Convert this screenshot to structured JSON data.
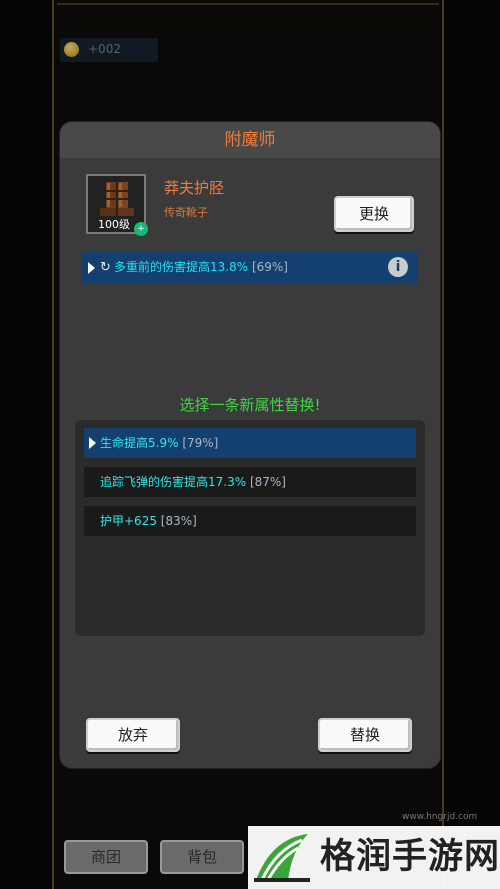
{
  "background": {
    "coin_value": "+002",
    "bottom_buttons": [
      "商团",
      "背包"
    ]
  },
  "dialog": {
    "title": "附魔师",
    "item": {
      "name": "莽夫护胫",
      "type": "传奇靴子",
      "level": "100级"
    },
    "replace_button": "更换",
    "current_attribute": {
      "text": "多重前的伤害提高13.8%",
      "percent": "[69%]"
    },
    "prompt": "选择一条新属性替换!",
    "options": [
      {
        "text": "生命提高5.9%",
        "percent": "[79%]",
        "selected": true
      },
      {
        "text": "追踪飞弹的伤害提高17.3%",
        "percent": "[87%]",
        "selected": false
      },
      {
        "text": "护甲+625",
        "percent": "[83%]",
        "selected": false
      }
    ],
    "abandon_button": "放弃",
    "swap_button": "替换"
  },
  "watermark": {
    "brand": "格润手游网",
    "url": "www.hngrjd.com"
  },
  "colors": {
    "title_orange": "#f07a3c",
    "attr_cyan": "#30e6e6",
    "prompt_green": "#3fd73f",
    "selected_blue": "#13406e"
  },
  "icons": [
    "coin-icon",
    "boot-icon",
    "play-icon",
    "refresh-icon",
    "info-icon",
    "watermark-logo-icon"
  ]
}
